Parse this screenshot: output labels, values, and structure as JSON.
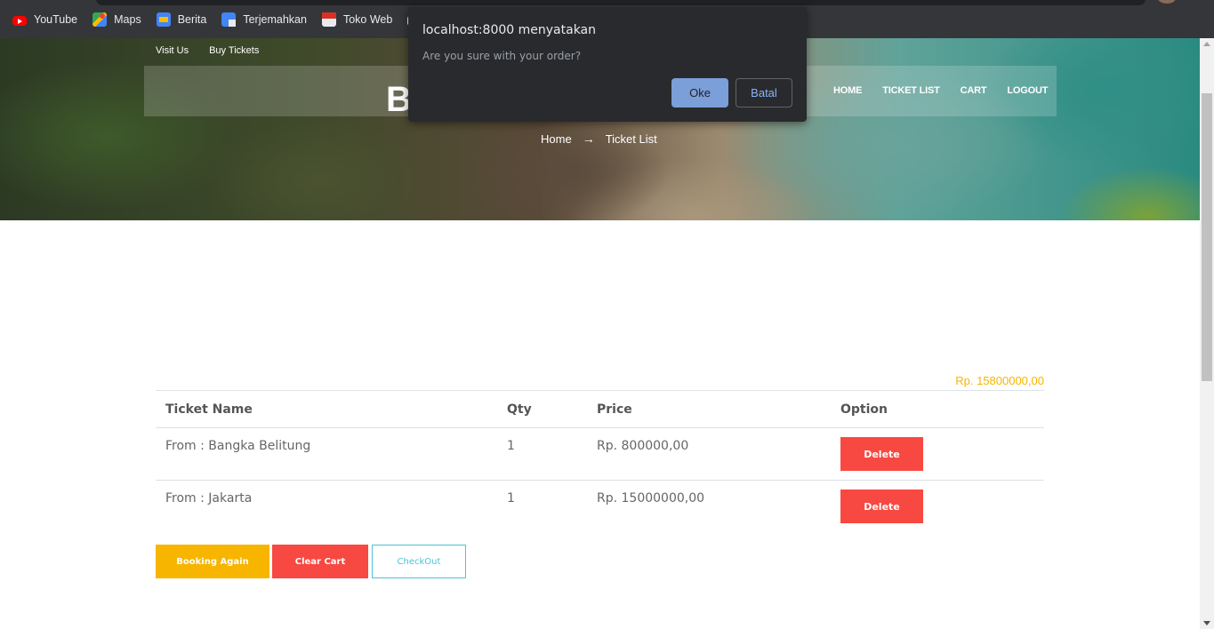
{
  "bookmarks": [
    {
      "label": "YouTube",
      "icon": "youtube-icon"
    },
    {
      "label": "Maps",
      "icon": "maps-icon"
    },
    {
      "label": "Berita",
      "icon": "news-icon"
    },
    {
      "label": "Terjemahkan",
      "icon": "translate-icon"
    },
    {
      "label": "Toko Web",
      "icon": "webstore-icon"
    },
    {
      "label": "",
      "icon": "gmail-icon"
    }
  ],
  "hero": {
    "topnav": [
      "Visit Us",
      "Buy Tickets"
    ],
    "brand": "B",
    "menu": [
      "HOME",
      "TICKET LIST",
      "CART",
      "LOGOUT"
    ],
    "breadcrumb": {
      "home": "Home",
      "separator": "→",
      "current": "Ticket List"
    }
  },
  "cart": {
    "total": "Rp. 15800000,00",
    "headers": {
      "name": "Ticket Name",
      "qty": "Qty",
      "price": "Price",
      "option": "Option"
    },
    "rows": [
      {
        "name": "From : Bangka Belitung",
        "qty": "1",
        "price": "Rp. 800000,00",
        "action": "Delete"
      },
      {
        "name": "From : Jakarta",
        "qty": "1",
        "price": "Rp. 15000000,00",
        "action": "Delete"
      }
    ],
    "buttons": {
      "booking_again": "Booking Again",
      "clear_cart": "Clear Cart",
      "checkout": "CheckOut"
    }
  },
  "dialog": {
    "title": "localhost:8000 menyatakan",
    "message": "Are you sure with your order?",
    "ok": "Oke",
    "cancel": "Batal"
  },
  "colors": {
    "accent_yellow": "#f7b500",
    "danger_red": "#f74941",
    "checkout_cyan": "#4cc3d3",
    "dialog_bg": "#292a2d",
    "dialog_primary": "#8ab4f8"
  }
}
